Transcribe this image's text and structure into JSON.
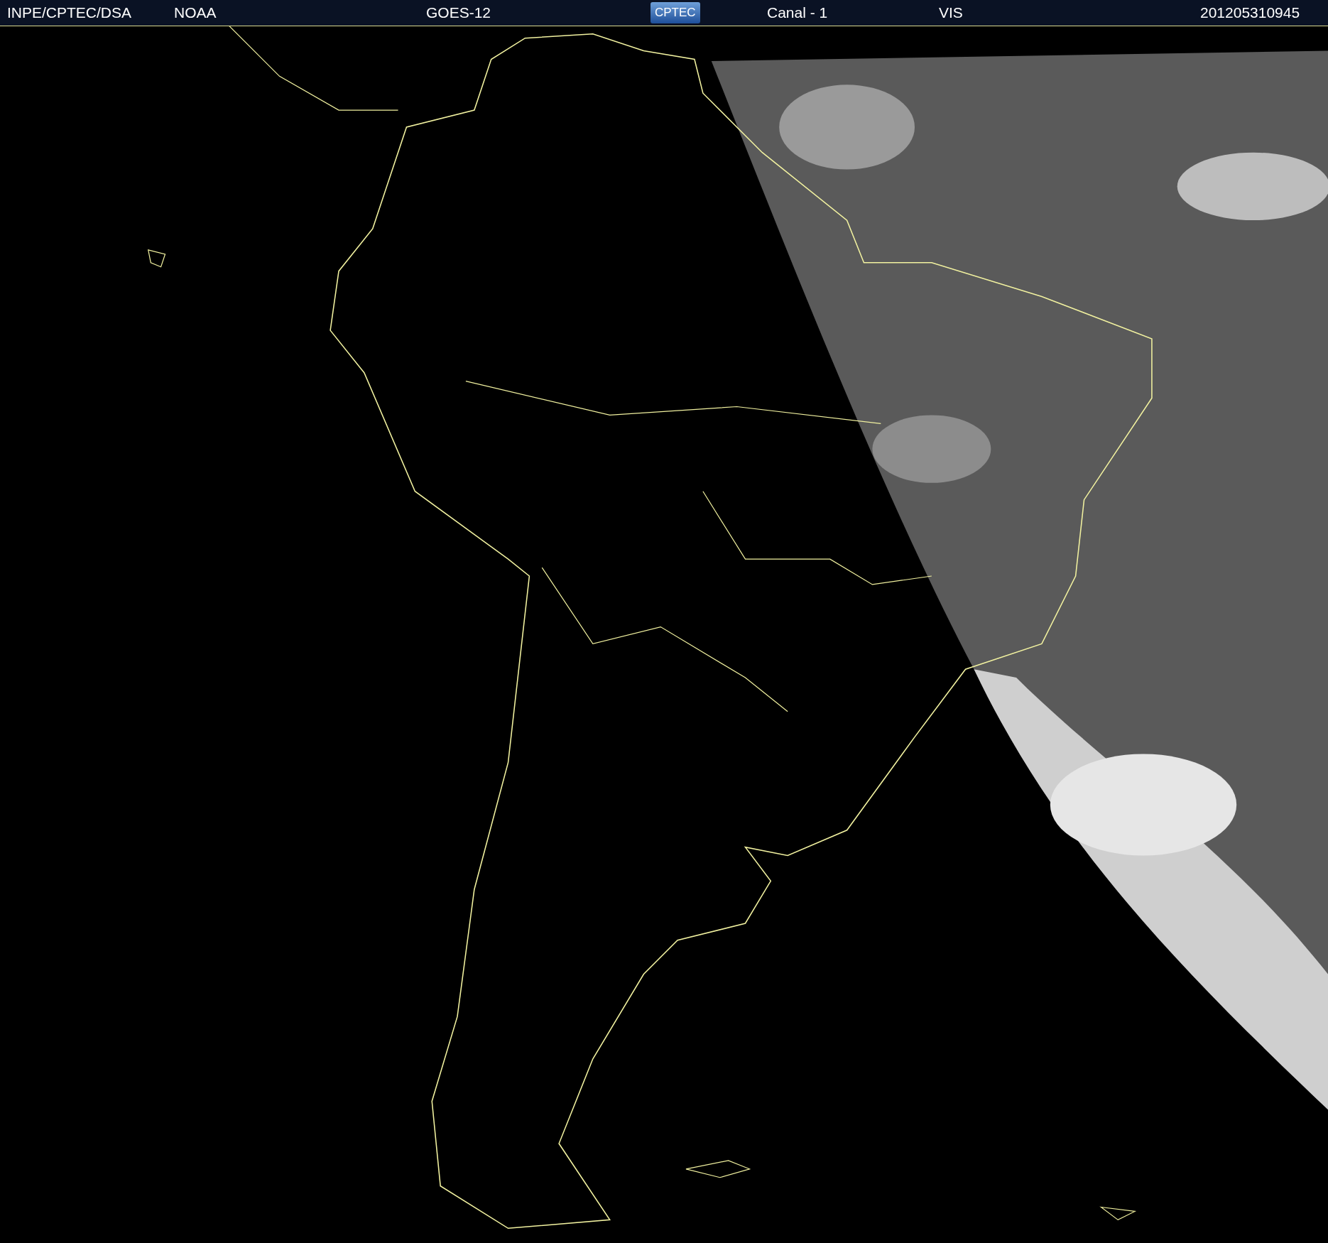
{
  "header": {
    "items": [
      {
        "kind": "text",
        "text": "INPE/CPTEC/DSA"
      },
      {
        "kind": "text",
        "text": "NOAA"
      },
      {
        "kind": "text",
        "text": "GOES-12"
      },
      {
        "kind": "logo",
        "text": "CPTEC"
      },
      {
        "kind": "text",
        "text": "Canal - 1"
      },
      {
        "kind": "text",
        "text": "VIS"
      },
      {
        "kind": "text",
        "text": "201205310945"
      }
    ]
  }
}
